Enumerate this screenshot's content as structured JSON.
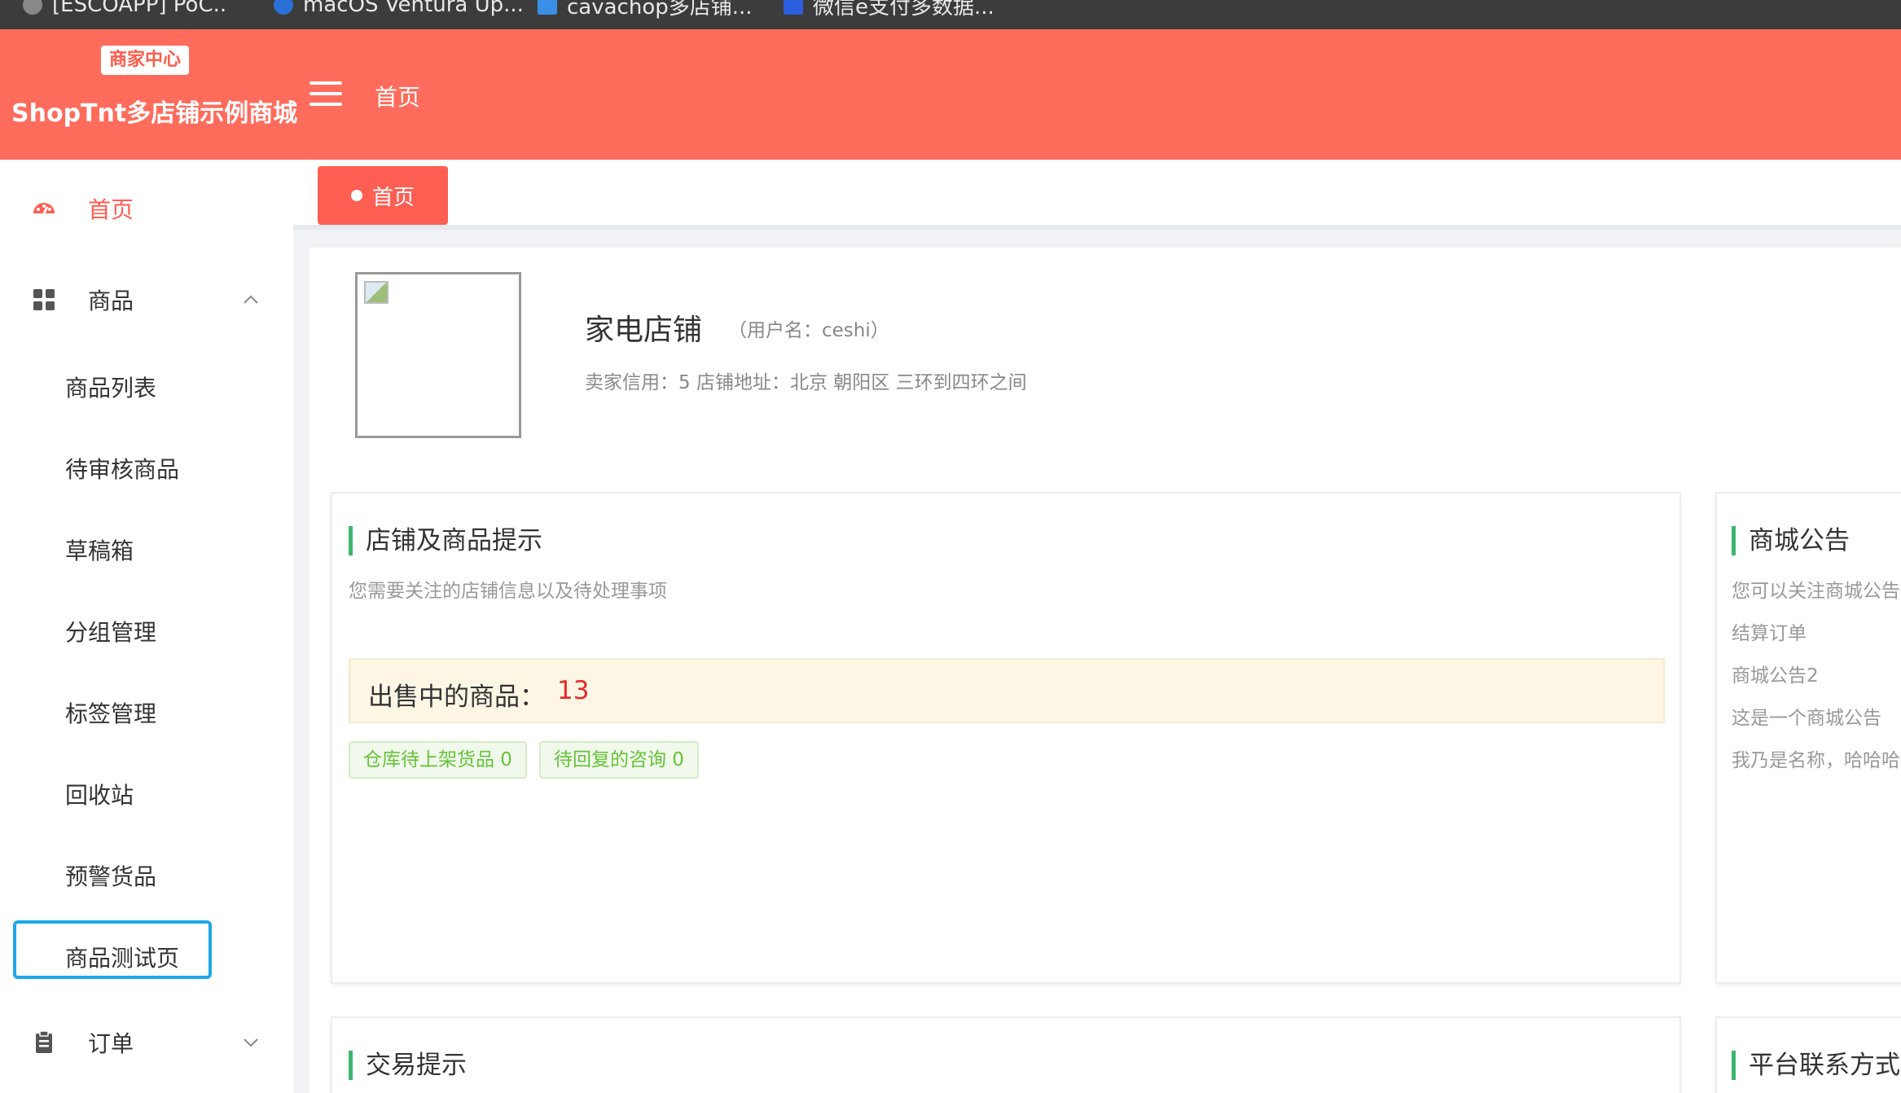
{
  "browser": {
    "bookmarks": [
      "[ESCOAPP] PoC..",
      "macOS Ventura Up...",
      "cavachop多店铺...",
      "微信e支付多数据..."
    ]
  },
  "header": {
    "badge": "商家中心",
    "brand": "ShopTnt多店铺示例商城",
    "home": "首页"
  },
  "sidebar": {
    "home": "首页",
    "goods": "商品",
    "goods_items": [
      "商品列表",
      "待审核商品",
      "草稿箱",
      "分组管理",
      "标签管理",
      "回收站",
      "预警货品",
      "商品测试页"
    ],
    "order": "订单"
  },
  "tabs": {
    "active": "首页"
  },
  "shop": {
    "name": "家电店铺",
    "username": "（用户名：ceshi）",
    "info": "卖家信用：5  店铺地址：北京 朝阳区 三环到四环之间"
  },
  "tips_card": {
    "title": "店铺及商品提示",
    "subtitle": "您需要关注的店铺信息以及待处理事项",
    "onsale_label": "出售中的商品：",
    "onsale_value": "13",
    "tags": [
      "仓库待上架货品 0",
      "待回复的咨询 0"
    ]
  },
  "notice_card": {
    "title": "商城公告",
    "subtitle": "您可以关注商城公告",
    "items": [
      "结算订单",
      "商城公告2",
      "这是一个商城公告",
      "我乃是名称，哈哈哈"
    ]
  },
  "trade_card": {
    "title": "交易提示"
  },
  "contact_card": {
    "title": "平台联系方式"
  },
  "colors": {
    "header": "#ff6c5c",
    "accent": "#ff5e52",
    "green": "#3db56e",
    "selected_outline": "#1ea7e8"
  }
}
